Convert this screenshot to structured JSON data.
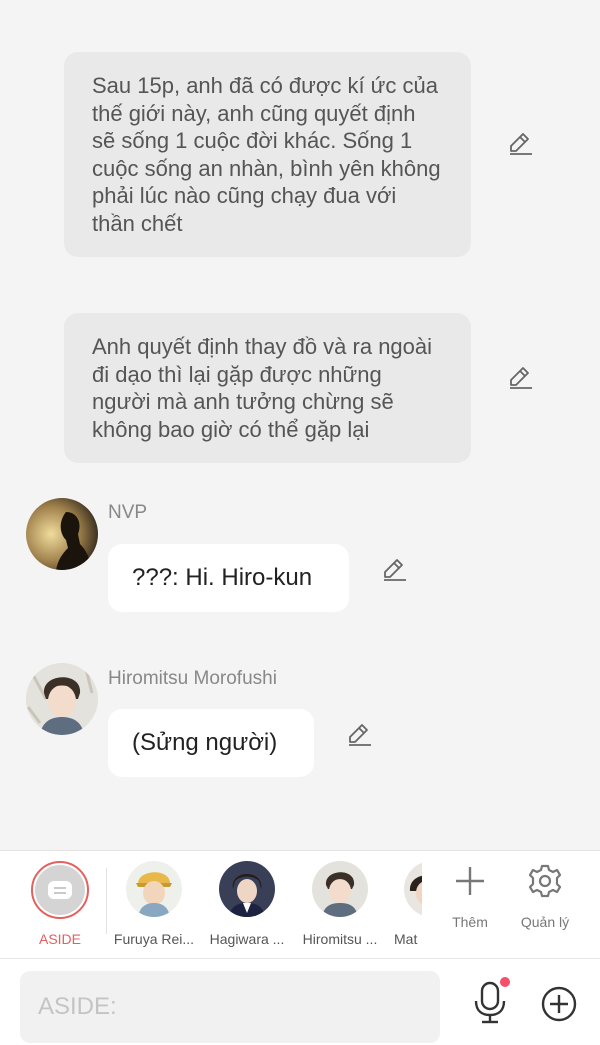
{
  "messages": {
    "narration1": "Sau 15p, anh đã có được kí ức của thế giới này, anh cũng quyết định sẽ sống 1 cuộc đời khác. Sống 1 cuộc sống an nhàn, bình yên không phải lúc nào cũng chạy đua với thần chết",
    "narration2": "Anh quyết định thay đồ và ra ngoài đi dạo thì lại gặp được những người mà anh tưởng chừng sẽ không bao giờ có thể gặp lại",
    "chat1": {
      "sender": "NVP",
      "text": "???: Hi. Hiro-kun"
    },
    "chat2": {
      "sender": "Hiromitsu Morofushi",
      "text": "(Sửng người)"
    }
  },
  "characters": [
    {
      "label": "ASIDE",
      "icon": "aside-icon",
      "selected": true
    },
    {
      "label": "Furuya Rei..."
    },
    {
      "label": "Hagiwara ..."
    },
    {
      "label": "Hiromitsu ..."
    },
    {
      "label": "Mat"
    }
  ],
  "tools": {
    "add_label": "Thêm",
    "manage_label": "Quản lý"
  },
  "input": {
    "placeholder": "ASIDE:"
  },
  "colors": {
    "accent": "#e3605f",
    "notification_dot": "#f2506a",
    "narration_bg": "#e9e9e9",
    "bubble_bg": "#ffffff"
  }
}
